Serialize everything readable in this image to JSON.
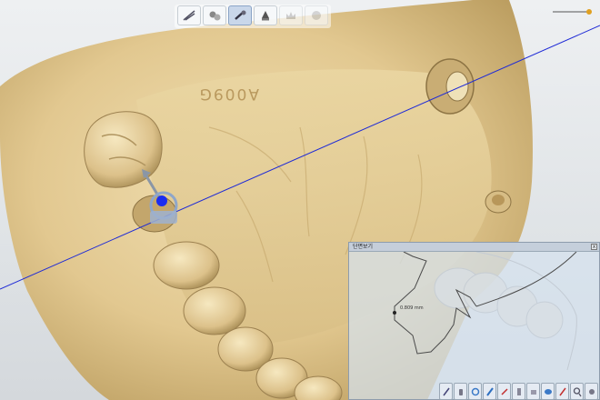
{
  "viewport": {
    "arch_engraving": "A009G",
    "background_color": "#e3e6e9",
    "model_color": "#e6d09c",
    "section_line_color": "#1f2bd6"
  },
  "toolbar": {
    "buttons": [
      {
        "name": "scan-tool-icon",
        "state": "normal"
      },
      {
        "name": "teeth-tool-icon",
        "state": "normal"
      },
      {
        "name": "implant-tool-icon",
        "state": "active"
      },
      {
        "name": "abutment-tool-icon",
        "state": "normal"
      },
      {
        "name": "crown-tool-icon",
        "state": "disabled"
      },
      {
        "name": "sphere-tool-icon",
        "state": "disabled"
      }
    ]
  },
  "cross_section_panel": {
    "title": "단면보기",
    "close_label": "x",
    "measurement": "0.809 mm"
  },
  "bottom_toolbar": {
    "buttons": [
      {
        "name": "pen-tool-icon"
      },
      {
        "name": "hand-tool-icon"
      },
      {
        "name": "rotate-tool-icon"
      },
      {
        "name": "measure-tool-icon"
      },
      {
        "name": "eraser-tool-icon"
      },
      {
        "name": "ruler-tool-icon"
      },
      {
        "name": "slice-tool-icon"
      },
      {
        "name": "view-tool-icon"
      },
      {
        "name": "brush-tool-icon"
      },
      {
        "name": "zoom-tool-icon"
      },
      {
        "name": "settings-tool-icon"
      }
    ]
  }
}
